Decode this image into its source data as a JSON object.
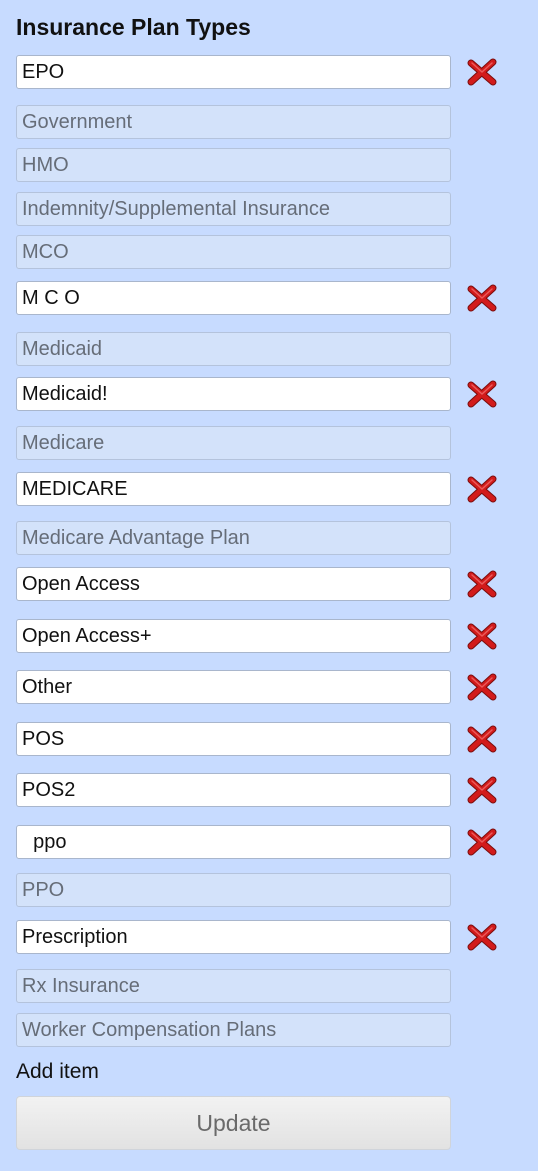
{
  "title": "Insurance Plan Types",
  "items": [
    {
      "label": "EPO",
      "editable": true
    },
    {
      "label": "Government",
      "editable": false
    },
    {
      "label": "HMO",
      "editable": false
    },
    {
      "label": "Indemnity/Supplemental Insurance",
      "editable": false
    },
    {
      "label": "MCO",
      "editable": false
    },
    {
      "label": "M C O",
      "editable": true
    },
    {
      "label": "Medicaid",
      "editable": false
    },
    {
      "label": "Medicaid!",
      "editable": true
    },
    {
      "label": "Medicare",
      "editable": false
    },
    {
      "label": "MEDICARE",
      "editable": true
    },
    {
      "label": "Medicare Advantage Plan",
      "editable": false
    },
    {
      "label": "Open Access",
      "editable": true
    },
    {
      "label": "Open Access+",
      "editable": true
    },
    {
      "label": "Other",
      "editable": true
    },
    {
      "label": "POS",
      "editable": true
    },
    {
      "label": "POS2",
      "editable": true
    },
    {
      "label": "  ppo",
      "editable": true
    },
    {
      "label": "PPO",
      "editable": false
    },
    {
      "label": "Prescription",
      "editable": true
    },
    {
      "label": "Rx Insurance",
      "editable": false
    },
    {
      "label": "Worker Compensation Plans",
      "editable": false
    }
  ],
  "add_item_label": "Add item",
  "update_button_label": "Update",
  "remove_icon": "red-x-icon",
  "colors": {
    "background": "#c7dbff",
    "remove_icon": "#d21b1b"
  }
}
